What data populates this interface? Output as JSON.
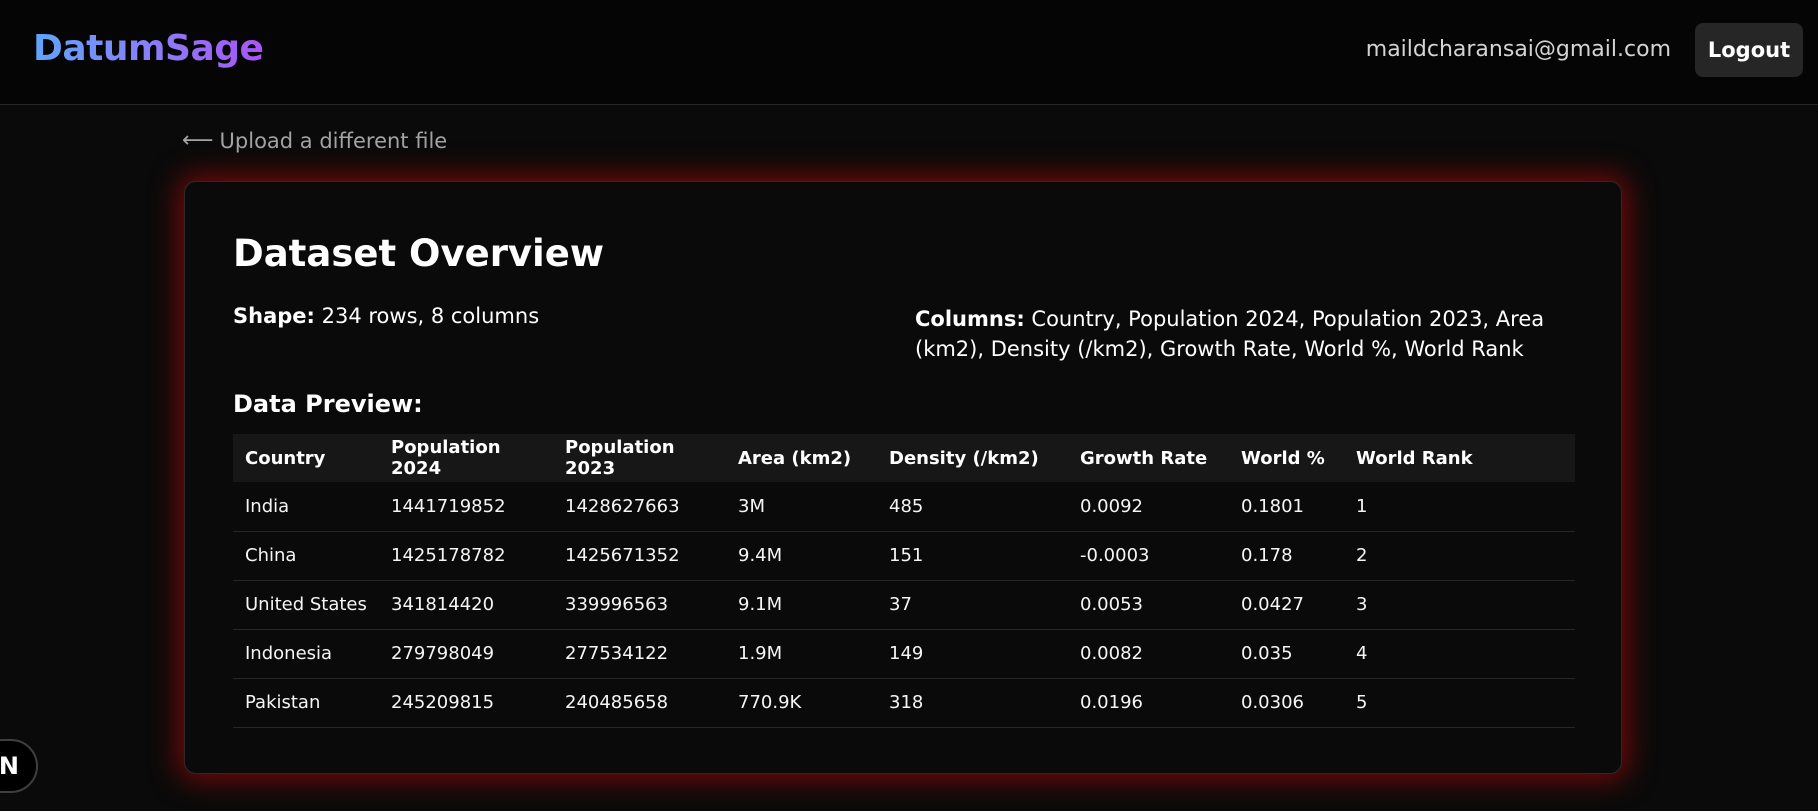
{
  "header": {
    "logo": "DatumSage",
    "user_email": "maildcharansai@gmail.com",
    "logout_label": "Logout"
  },
  "back_link": {
    "arrow": "⟵",
    "label": "Upload a different file"
  },
  "overview": {
    "title": "Dataset Overview",
    "shape_label": "Shape:",
    "shape_value": "234 rows, 8 columns",
    "columns_label": "Columns:",
    "columns_value": "Country, Population 2024, Population 2023, Area (km2), Density (/km2), Growth Rate, World %, World Rank",
    "preview_title": "Data Preview:"
  },
  "table": {
    "headers": [
      "Country",
      "Population 2024",
      "Population 2023",
      "Area (km2)",
      "Density (/km2)",
      "Growth Rate",
      "World %",
      "World Rank"
    ],
    "rows": [
      [
        "India",
        "1441719852",
        "1428627663",
        "3M",
        "485",
        "0.0092",
        "0.1801",
        "1"
      ],
      [
        "China",
        "1425178782",
        "1425671352",
        "9.4M",
        "151",
        "-0.0003",
        "0.178",
        "2"
      ],
      [
        "United States",
        "341814420",
        "339996563",
        "9.1M",
        "37",
        "0.0053",
        "0.0427",
        "3"
      ],
      [
        "Indonesia",
        "279798049",
        "277534122",
        "1.9M",
        "149",
        "0.0082",
        "0.035",
        "4"
      ],
      [
        "Pakistan",
        "245209815",
        "240485658",
        "770.9K",
        "318",
        "0.0196",
        "0.0306",
        "5"
      ]
    ]
  },
  "dev_badge": {
    "letter": "N"
  }
}
